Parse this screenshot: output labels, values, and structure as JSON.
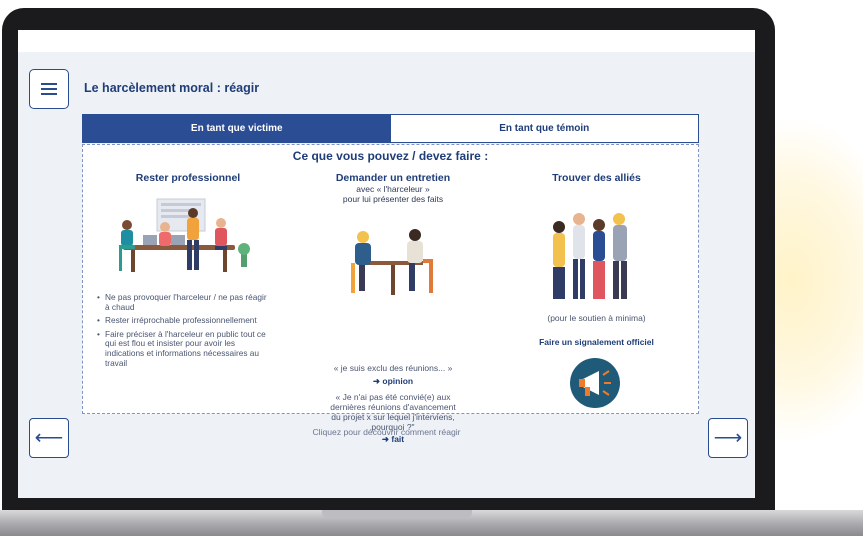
{
  "app": {
    "title": "Le harcèlement moral : réagir"
  },
  "tabs": [
    {
      "label": "En tant que victime",
      "active": true
    },
    {
      "label": "En tant que témoin",
      "active": false
    }
  ],
  "panel": {
    "heading": "Ce que vous pouvez / devez faire :",
    "col1": {
      "title": "Rester professionnel",
      "bullets": [
        "Ne pas provoquer l'harceleur / ne pas réagir à chaud",
        "Rester irréprochable professionnellement",
        "Faire préciser à l'harceleur en public tout ce qui est flou et insister pour avoir les indications et informations nécessaires au travail"
      ]
    },
    "col2": {
      "title": "Demander un entretien",
      "sub1": "avec « l'harceleur »",
      "sub2": "pour lui présenter des faits",
      "quote1": "« je suis exclu des réunions... »",
      "arrow1": "➜ opinion",
      "quote2_l1": "« Je n'ai pas été convié(e) aux",
      "quote2_l2": "dernières réunions d'avancement",
      "quote2_l3": "du projet x sur lequel j'interviens,",
      "quote2_l4": "pourquoi ?\"",
      "arrow2": "➜ fait"
    },
    "col3": {
      "title": "Trouver des alliés",
      "note": "(pour le soutien à minima)",
      "strong": "Faire un signalement officiel"
    }
  },
  "footer": {
    "caption": "Cliquez pour découvrir comment réagir"
  },
  "nav": {
    "prev_glyph": "⟵",
    "next_glyph": "⟶"
  },
  "colors": {
    "brand": "#2a4d94",
    "accent_orange": "#f07a2a",
    "megaphone_bg": "#1f5b78"
  },
  "icons": [
    "menu-icon",
    "megaphone-icon",
    "arrow-left-icon",
    "arrow-right-icon"
  ]
}
